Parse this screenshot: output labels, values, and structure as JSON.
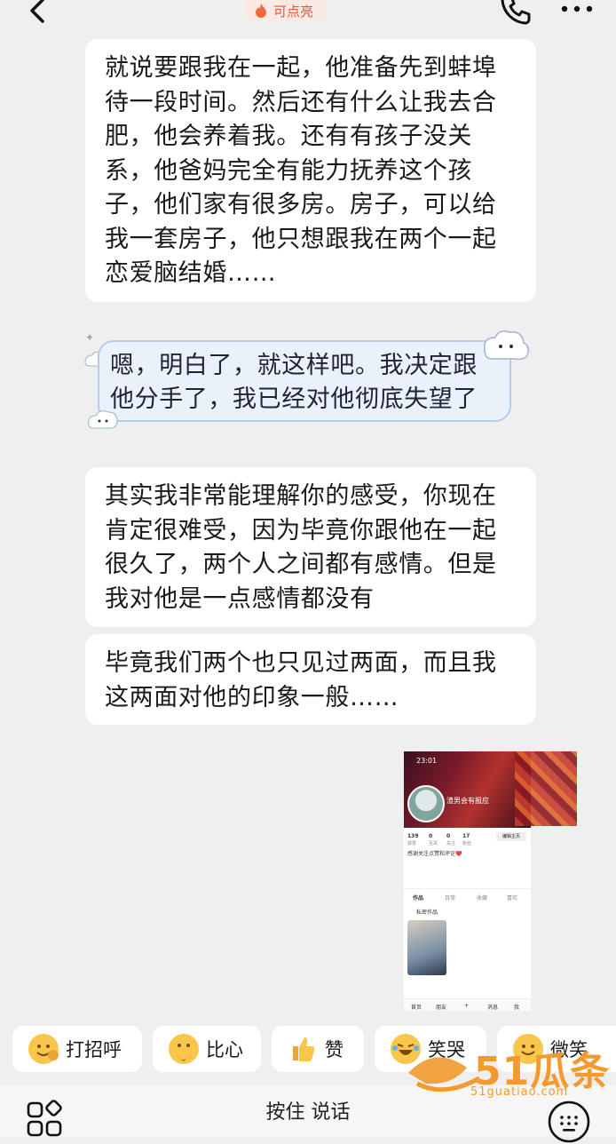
{
  "header": {
    "badge_label": "可点亮"
  },
  "messages": {
    "m1": "就说要跟我在一起，他准备先到蚌埠待一段时间。然后还有什么让我去合肥，他会养着我。还有有孩子没关系，他爸妈完全有能力抚养这个孩子，他们家有很多房。房子，可以给我一套房子，他只想跟我在两个一起恋爱脑结婚……",
    "m2": "嗯，明白了，就这样吧。我决定跟他分手了，我已经对他彻底失望了",
    "m3": "其实我非常能理解你的感受，你现在肯定很难受，因为毕竟你跟他在一起很久了，两个人之间都有感情。但是我对他是一点感情都没有",
    "m4": "毕竟我们两个也只见过两面，而且我这两面对他的印象一般……"
  },
  "screenshot": {
    "time": "23:01",
    "name": "渣男会有报应",
    "stats": [
      {
        "num": "139",
        "label": "获赞"
      },
      {
        "num": "0",
        "label": "互关"
      },
      {
        "num": "0",
        "label": "关注"
      },
      {
        "num": "17",
        "label": "粉丝"
      }
    ],
    "edit_label": "编辑主页",
    "bio": "感谢关注点赞和评论❤️",
    "tabs": [
      "作品",
      "日常",
      "收藏",
      "喜欢"
    ],
    "private_label": "私密作品",
    "nav": [
      "首页",
      "朋友",
      "+",
      "消息",
      "我"
    ]
  },
  "quick_replies": [
    {
      "label": "打招呼",
      "icon": "wave-emoji-icon"
    },
    {
      "label": "比心",
      "icon": "heart-hands-emoji-icon"
    },
    {
      "label": "赞",
      "icon": "thumbs-up-emoji-icon"
    },
    {
      "label": "笑哭",
      "icon": "laugh-cry-emoji-icon"
    },
    {
      "label": "微笑",
      "icon": "smile-emoji-icon"
    }
  ],
  "input": {
    "voice_label": "按住 说话"
  },
  "watermark": {
    "brand": "51瓜条",
    "url": "51guatiao.com"
  },
  "colors": {
    "badge_text": "#e2583c",
    "accent": "#f29a2e",
    "bubble_mine_bg": "#e9f1fb"
  }
}
